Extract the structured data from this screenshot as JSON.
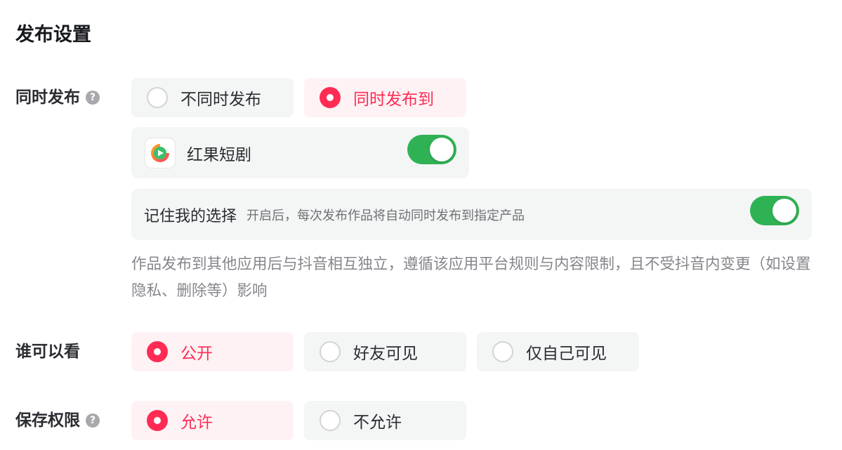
{
  "title": "发布设置",
  "sync_publish": {
    "label": "同时发布",
    "options": [
      {
        "label": "不同时发布",
        "selected": false
      },
      {
        "label": "同时发布到",
        "selected": true
      }
    ],
    "app": {
      "name": "红果短剧",
      "enabled": true
    },
    "remember": {
      "label": "记住我的选择",
      "description": "开启后，每次发布作品将自动同时发布到指定产品",
      "enabled": true
    },
    "note": "作品发布到其他应用后与抖音相互独立，遵循该应用平台规则与内容限制，且不受抖音内变更（如设置隐私、删除等）影响"
  },
  "visibility": {
    "label": "谁可以看",
    "options": [
      {
        "label": "公开",
        "selected": true
      },
      {
        "label": "好友可见",
        "selected": false
      },
      {
        "label": "仅自己可见",
        "selected": false
      }
    ]
  },
  "save_permission": {
    "label": "保存权限",
    "options": [
      {
        "label": "允许",
        "selected": true
      },
      {
        "label": "不允许",
        "selected": false
      }
    ]
  },
  "colors": {
    "accent": "#fe2c55",
    "toggle_on": "#2fb254",
    "option_bg": "#f4f5f5",
    "option_selected_bg": "#fff2f4"
  },
  "icons": {
    "help": "question-circle-icon",
    "app": "hongguo-play-icon"
  }
}
